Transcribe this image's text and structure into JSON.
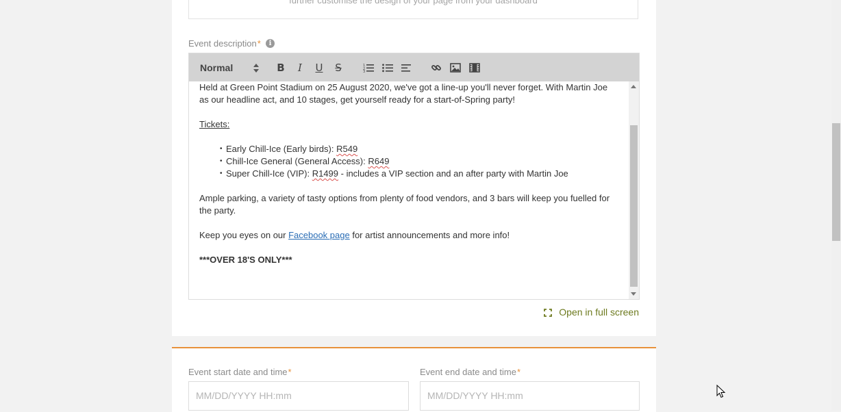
{
  "help_text": "further customise the design of your page from your dashboard",
  "description": {
    "label": "Event description",
    "required_mark": "*",
    "info_icon": "info-icon"
  },
  "toolbar": {
    "format_value": "Normal",
    "buttons": [
      "bold-icon",
      "italic-icon",
      "underline-icon",
      "strikethrough-icon",
      "ordered-list-icon",
      "bullet-list-icon",
      "align-icon",
      "link-icon",
      "image-icon",
      "video-icon"
    ]
  },
  "content": {
    "para1": "Held at Green Point Stadium on 25 August 2020, we've got a line-up you'll never forget. With Martin Joe as our headline act, and 10 stages, get yourself ready for a start-of-Spring party!",
    "tickets_heading": "Tickets:",
    "tickets": [
      {
        "text": "Early Chill-Ice (Early birds): ",
        "price": "R549",
        "suffix": ""
      },
      {
        "text": "Chill-Ice General (General Access): ",
        "price": "R649",
        "suffix": ""
      },
      {
        "text": "Super Chill-Ice (VIP): ",
        "price": "R1499",
        "suffix": " - includes a VIP section and an after party with Martin Joe"
      }
    ],
    "para2": "Ample parking, a variety of tasty options from plenty of food vendors, and 3 bars will keep you fuelled for the party.",
    "para3_before": "Keep you eyes on our ",
    "para3_link": "Facebook page",
    "para3_after": " for artist announcements and more info!",
    "notice": "***OVER 18'S ONLY***"
  },
  "fullscreen_label": "Open in full screen",
  "start": {
    "label": "Event start date and time",
    "required_mark": "*",
    "placeholder": "MM/DD/YYYY HH:mm"
  },
  "end": {
    "label": "Event end date and time",
    "required_mark": "*",
    "placeholder": "MM/DD/YYYY HH:mm"
  },
  "colors": {
    "accent": "#e8913a",
    "link": "#2a6db5",
    "fullscreen": "#6d7a1f"
  }
}
